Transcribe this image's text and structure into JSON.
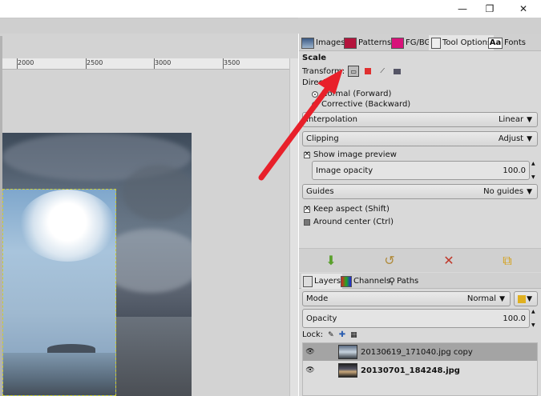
{
  "window": {
    "minimize_glyph": "—",
    "restore_glyph": "❐",
    "close_glyph": "✕"
  },
  "ruler": {
    "labels": [
      "2000",
      "2500",
      "3000",
      "3500"
    ]
  },
  "dock_tabs": [
    {
      "label": "Images",
      "icon": "images-icon"
    },
    {
      "label": "Patterns",
      "icon": "patterns-icon"
    },
    {
      "label": "FG/BG",
      "icon": "fgbg-icon"
    },
    {
      "label": "Tool Options",
      "icon": "tool-options-icon"
    },
    {
      "label": "Fonts",
      "icon": "fonts-icon",
      "icon_text": "Aa"
    }
  ],
  "tool_options": {
    "title": "Scale",
    "transform_label": "Transform:",
    "direction_label": "Direction",
    "direction_options": [
      {
        "label": "Normal (Forward)",
        "selected": true
      },
      {
        "label": "Corrective (Backward)",
        "selected": false
      }
    ],
    "interpolation": {
      "label": "Interpolation",
      "value": "Linear"
    },
    "clipping": {
      "label": "Clipping",
      "value": "Adjust"
    },
    "show_preview": {
      "label": "Show image preview",
      "checked": true
    },
    "image_opacity": {
      "label": "Image opacity",
      "value": "100.0"
    },
    "guides": {
      "label": "Guides",
      "value": "No guides"
    },
    "keep_aspect": {
      "label": "Keep aspect (Shift)",
      "checked": true
    },
    "around_center": {
      "label": "Around center (Ctrl)",
      "checked": false
    }
  },
  "actions": {
    "restore_icon": "restore-icon",
    "reset_icon": "reset-icon",
    "delete_icon": "delete-icon",
    "save_icon": "save-icon"
  },
  "layers_tabs": [
    {
      "label": "Layers",
      "icon": "layers-icon"
    },
    {
      "label": "Channels",
      "icon": "channels-icon"
    },
    {
      "label": "Paths",
      "icon": "paths-icon"
    }
  ],
  "layers": {
    "mode": {
      "label": "Mode",
      "value": "Normal"
    },
    "opacity": {
      "label": "Opacity",
      "value": "100.0"
    },
    "lock_label": "Lock:",
    "items": [
      {
        "name": "20130619_171040.jpg copy",
        "selected": true,
        "bold": false
      },
      {
        "name": "20130701_184248.jpg",
        "selected": false,
        "bold": true
      }
    ]
  },
  "colors": {
    "arrow": "#e8202a",
    "selection_border": "#cccc33",
    "delete_red": "#c0392b",
    "restore_green": "#5aa02c"
  }
}
